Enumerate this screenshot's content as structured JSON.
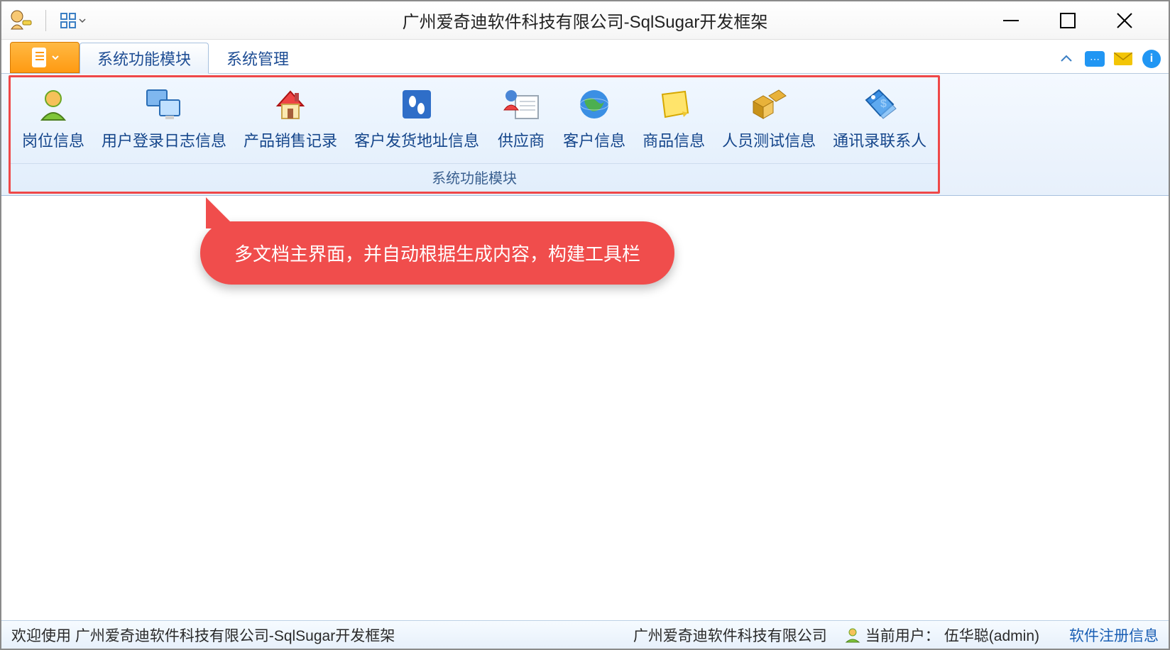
{
  "window": {
    "title": "广州爱奇迪软件科技有限公司-SqlSugar开发框架"
  },
  "tabs": {
    "active": "系统功能模块",
    "inactive": "系统管理"
  },
  "ribbon": {
    "group_title": "系统功能模块",
    "buttons": [
      {
        "label": "岗位信息",
        "icon": "user-icon"
      },
      {
        "label": "用户登录日志信息",
        "icon": "monitors-icon"
      },
      {
        "label": "产品销售记录",
        "icon": "house-icon"
      },
      {
        "label": "客户发货地址信息",
        "icon": "footprint-icon"
      },
      {
        "label": "供应商",
        "icon": "contact-card-icon"
      },
      {
        "label": "客户信息",
        "icon": "globe-icon"
      },
      {
        "label": "商品信息",
        "icon": "note-icon"
      },
      {
        "label": "人员测试信息",
        "icon": "boxes-icon"
      },
      {
        "label": "通讯录联系人",
        "icon": "price-tag-icon"
      }
    ]
  },
  "callout": {
    "text": "多文档主界面，并自动根据生成内容，构建工具栏"
  },
  "statusbar": {
    "welcome": "欢迎使用 广州爱奇迪软件科技有限公司-SqlSugar开发框架",
    "company": "广州爱奇迪软件科技有限公司",
    "current_user_label": "当前用户：",
    "current_user_value": "伍华聪(admin)",
    "register_link": "软件注册信息"
  }
}
